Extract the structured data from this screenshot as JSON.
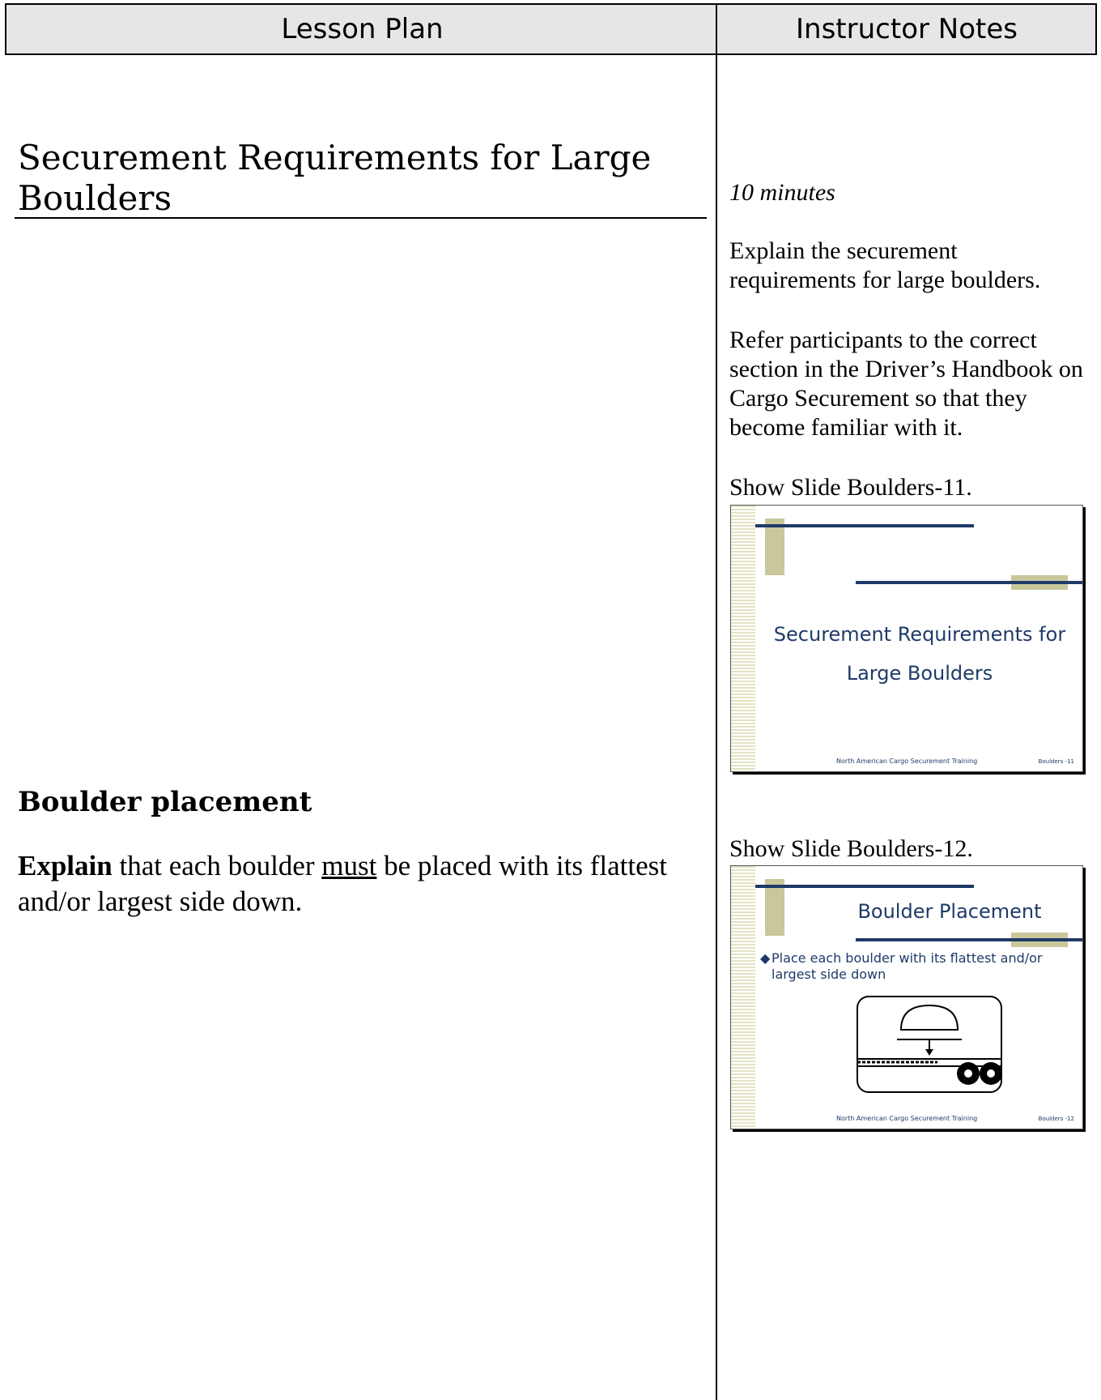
{
  "header": {
    "left_label": "Lesson Plan",
    "right_label": "Instructor Notes"
  },
  "lesson": {
    "section_title": "Securement Requirements for Large Boulders",
    "subsection_title": "Boulder placement",
    "body_bold": "Explain",
    "body_pre": " that each boulder ",
    "body_underlined": "must",
    "body_post": " be placed with its flattest and/or largest side down."
  },
  "notes": {
    "duration": "10 minutes",
    "p1": "Explain the securement requirements for large boulders.",
    "p2": "Refer participants to the correct section in the Driver’s Handbook on Cargo Securement so that they become familiar with it.",
    "show_slide_11": "Show Slide Boulders-11.",
    "show_slide_12": "Show Slide Boulders-12."
  },
  "slide11": {
    "title_line1": "Securement Requirements for",
    "title_line2": "Large Boulders",
    "footer": "North American Cargo Securement Training",
    "number": "Boulders -11"
  },
  "slide12": {
    "title": "Boulder Placement",
    "bullet": "Place each boulder with its flattest and/or largest side down",
    "footer": "North American Cargo Securement Training",
    "number": "Boulders -12"
  }
}
